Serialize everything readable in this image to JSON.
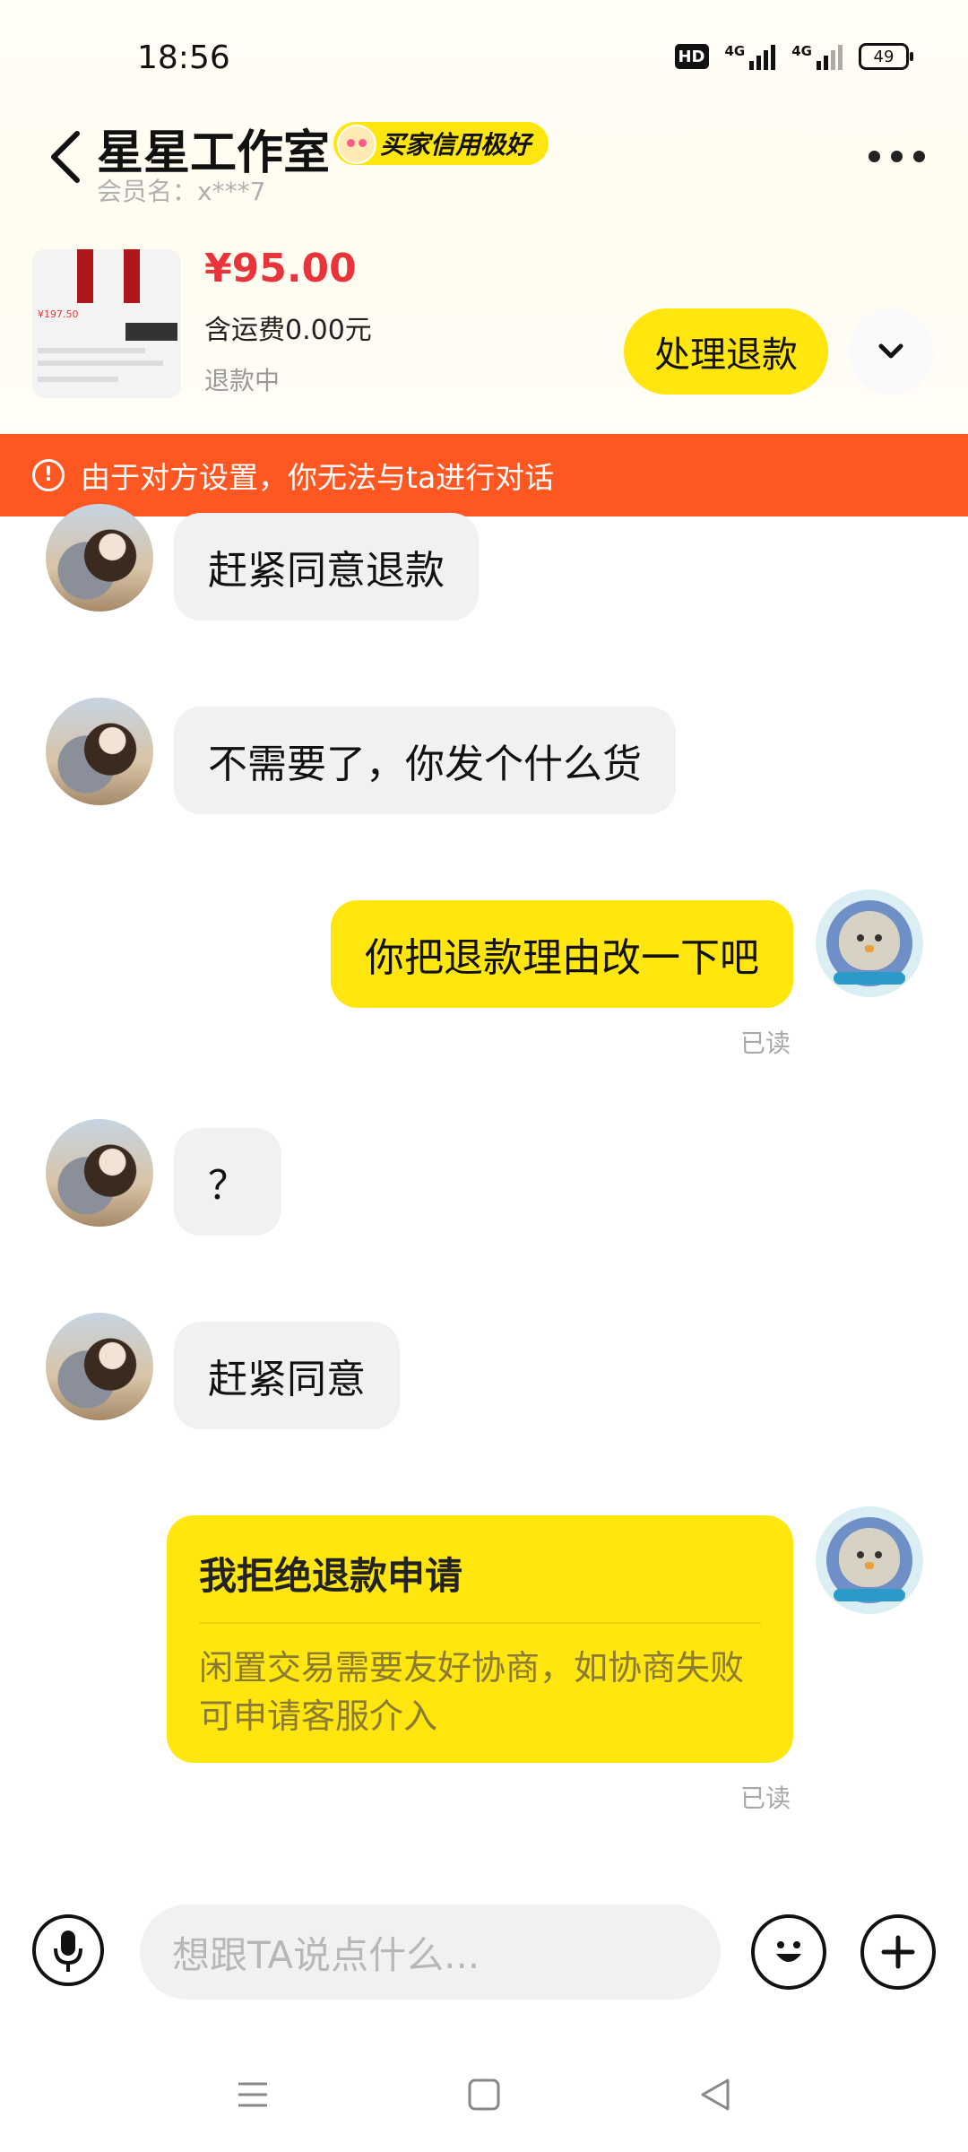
{
  "status_bar": {
    "time": "18:56",
    "hd_label": "HD",
    "net1_label": "4G",
    "net2_label": "4G",
    "battery": "49"
  },
  "header": {
    "shop_name": "星星工作室",
    "credit_badge": "买家信用极好",
    "member_label": "会员名：x***7"
  },
  "product": {
    "price": "¥95.00",
    "shipping": "含运费0.00元",
    "refund_status": "退款中",
    "refund_button": "处理退款",
    "thumb_price": "¥197.50",
    "colors": {
      "price": "#e8343a",
      "accent": "#ffe60f"
    }
  },
  "notice": {
    "text": "由于对方设置，你无法与ta进行对话",
    "color": "#ff5722"
  },
  "messages": {
    "m1": "赶紧同意退款",
    "m2": "不需要了，你发个什么货",
    "m3": "你把退款理由改一下吧",
    "m3_read": "已读",
    "m4": "？",
    "m5": "赶紧同意",
    "m6_title": "我拒绝退款申请",
    "m6_body": "闲置交易需要友好协商，如协商失败可申请客服介入",
    "m6_read": "已读"
  },
  "input_bar": {
    "placeholder": "想跟TA说点什么..."
  },
  "icons": [
    "back-icon",
    "more-icon",
    "chevron-down-icon",
    "warning-icon",
    "microphone-icon",
    "emoji-icon",
    "plus-icon",
    "menu-icon",
    "home-icon",
    "back-triangle-icon"
  ]
}
